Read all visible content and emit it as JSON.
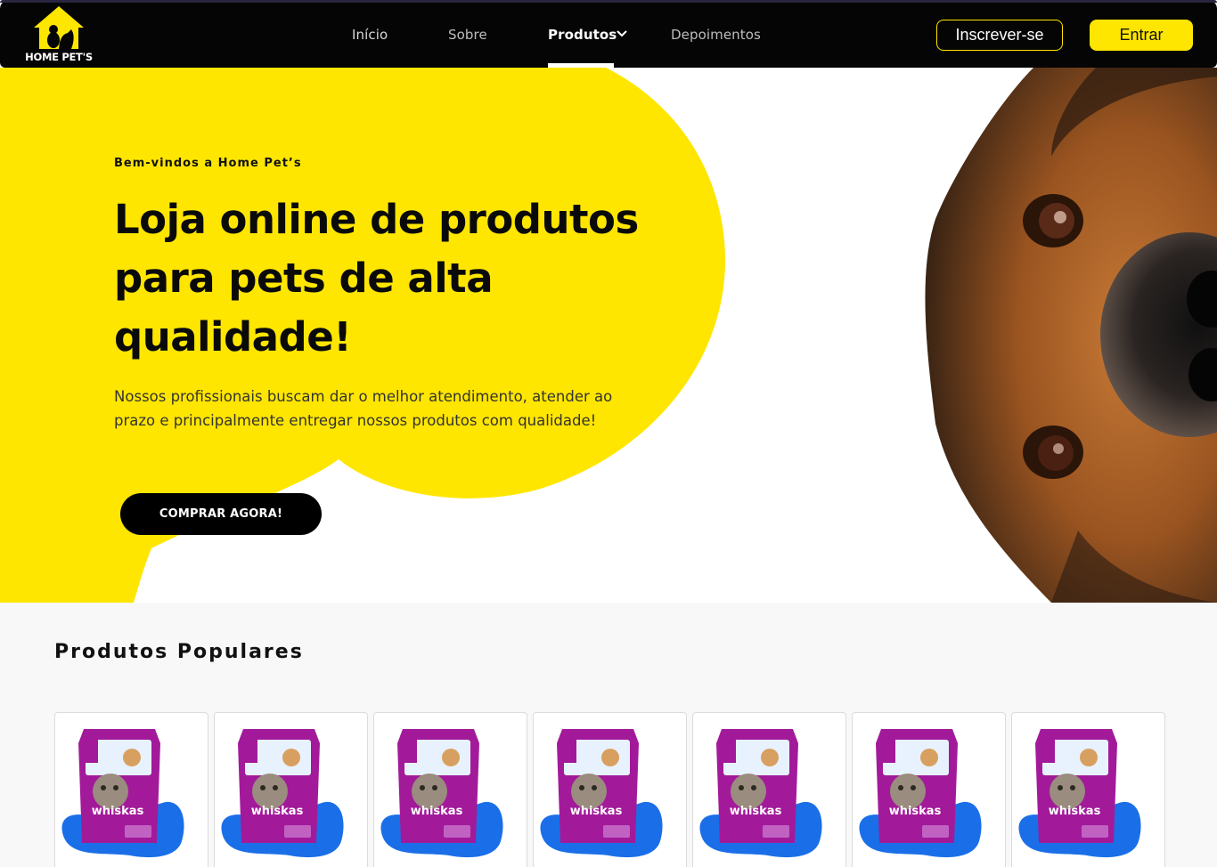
{
  "brand": {
    "name": "HOME PET'S"
  },
  "nav": {
    "links": [
      {
        "label": "Início"
      },
      {
        "label": "Sobre"
      },
      {
        "label": "Produtos"
      },
      {
        "label": "Depoimentos"
      }
    ],
    "active": "Produtos",
    "signup_label": "Inscrever-se",
    "login_label": "Entrar"
  },
  "hero": {
    "eyebrow": "Bem-vindos a Home Pet’s",
    "headline_lines": [
      "Loja online de produtos",
      "para pets de alta",
      "qualidade!"
    ],
    "lead_lines": [
      "Nossos profissionais buscam dar o melhor atendimento, atender ao",
      "prazo e principalmente entregar nossos produtos com qualidade!"
    ],
    "cta_label": "COMPRAR AGORA!"
  },
  "products": {
    "title": "Produtos Populares",
    "items": [
      {
        "brand": "whiskas"
      },
      {
        "brand": "whiskas"
      },
      {
        "brand": "whiskas"
      },
      {
        "brand": "whiskas"
      },
      {
        "brand": "whiskas"
      },
      {
        "brand": "whiskas"
      },
      {
        "brand": "whiskas"
      }
    ]
  },
  "colors": {
    "accent": "#ffe600",
    "nav_bg": "#050505",
    "package": "#a21a9a",
    "splash": "#1a6fe8"
  }
}
